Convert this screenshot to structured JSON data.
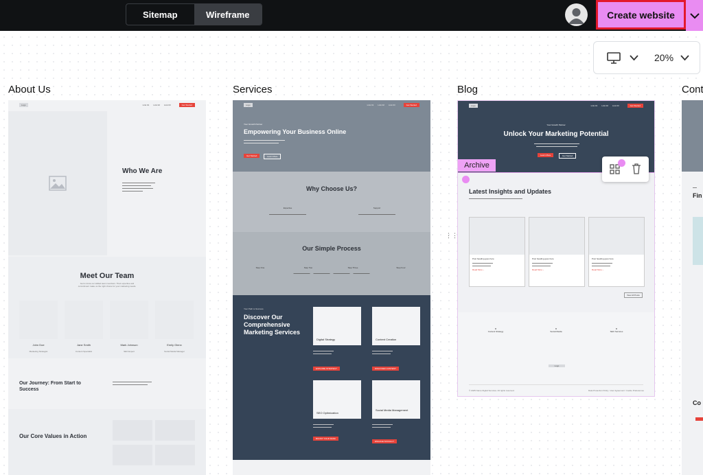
{
  "toolbar": {
    "tab_sitemap": "Sitemap",
    "tab_wireframe": "Wireframe",
    "create_label": "Create website",
    "zoom": "20%"
  },
  "columns": [
    {
      "title": "About Us"
    },
    {
      "title": "Services"
    },
    {
      "title": "Blog"
    },
    {
      "title": "Cont"
    }
  ],
  "mini": {
    "logo": "Logo",
    "link1": "Link 01",
    "link2": "Link 02",
    "link3": "Link 03",
    "cta": "Get Started"
  },
  "about": {
    "who": "Who We Are",
    "team": "Meet Our Team",
    "team_sub": "Get to know our skilled team members. Their expertise and commitment make us the right choice for your marketing needs.",
    "members": [
      {
        "name": "John Doe",
        "role": "Marketing Strategist"
      },
      {
        "name": "Jane Smith",
        "role": "Content Specialist"
      },
      {
        "name": "Mark Johnson",
        "role": "SEO Expert"
      },
      {
        "name": "Emily Glenn",
        "role": "Social Media Manager"
      }
    ],
    "journey": "Our Journey: From Start to Success",
    "values": "Our Core Values in Action"
  },
  "services": {
    "kicker": "Your Growth Partner",
    "hero": "Empowering Your Business Online",
    "btn1": "Get Started",
    "btn2": "Learn More",
    "why": "Why Choose Us?",
    "why_items": [
      "Expertise",
      "Support"
    ],
    "process": "Our Simple Process",
    "steps": [
      "Step One",
      "Step Two",
      "Step Three",
      "Step Four"
    ],
    "path_kicker": "Your Path to Success",
    "discover": "Discover Our Comprehensive Marketing Services",
    "cards": [
      {
        "title": "Digital Strategy",
        "cta": "EXPLORE STRATEGY"
      },
      {
        "title": "Content Creation",
        "cta": "DISCOVER CONTENT"
      },
      {
        "title": "SEO Optimization",
        "cta": "BOOST YOUR RANK"
      },
      {
        "title": "Social Media Management",
        "cta": "ENGAGE SOCIALLY"
      }
    ]
  },
  "blog": {
    "kicker": "Your Growth Partner",
    "hero": "Unlock Your Marketing Potential",
    "btn1": "Learn More",
    "btn2": "Get Started",
    "archive": "Archive",
    "latest": "Latest Insights and Updates",
    "posts": [
      {
        "title": "Post heading goes here",
        "cta": "Read More ›"
      },
      {
        "title": "Post heading goes here",
        "cta": "Read More ›"
      },
      {
        "title": "Post heading goes here",
        "cta": "Read More ›"
      }
    ],
    "view_all": "View All Posts",
    "features": [
      "Content Strategy",
      "Social Media",
      "SEO Services"
    ],
    "copyright": "© 2025 Name Digital Services. All rights reserved.",
    "legal": [
      "Data Protection Policy",
      "User Agreement",
      "Cookie Preferences"
    ]
  },
  "contact": {
    "fin": "Fin",
    "co": "Co"
  }
}
